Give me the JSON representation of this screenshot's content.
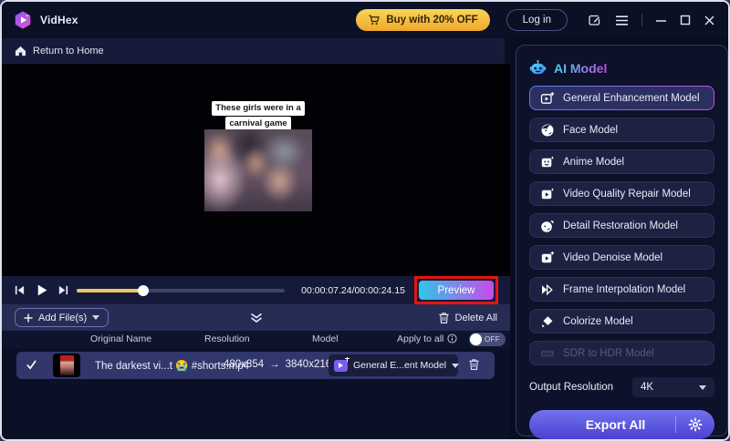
{
  "titlebar": {
    "app_name": "VidHex",
    "buy_label": "Buy with 20% OFF",
    "login_label": "Log in"
  },
  "nav": {
    "return_home": "Return to Home"
  },
  "player": {
    "caption_line1": "These girls were in a",
    "caption_line2": "carnival game",
    "time": "00:00:07.24/00:00:24.15",
    "progress_percent": 32,
    "preview_label": "Preview"
  },
  "file_toolbar": {
    "add_files_label": "Add File(s)",
    "delete_all_label": "Delete All"
  },
  "table": {
    "headers": {
      "original_name": "Original Name",
      "resolution": "Resolution",
      "model": "Model",
      "apply_to_all": "Apply to all"
    },
    "toggle_state": "OFF",
    "row": {
      "name": "The darkest vi...t 😭 #shorts.mp4",
      "resolution_from": "480x854",
      "arrow": "→",
      "resolution_to": "3840x2160",
      "model": "General E...ent Model"
    }
  },
  "ai_panel": {
    "title": "AI Model",
    "models": [
      {
        "label": "General Enhancement Model",
        "icon": "video-enhance-icon",
        "state": "selected"
      },
      {
        "label": "Face Model",
        "icon": "face-icon",
        "state": "default"
      },
      {
        "label": "Anime Model",
        "icon": "anime-icon",
        "state": "default"
      },
      {
        "label": "Video Quality Repair Model",
        "icon": "video-repair-icon",
        "state": "default"
      },
      {
        "label": "Detail Restoration Model",
        "icon": "detail-restoration-icon",
        "state": "default"
      },
      {
        "label": "Video Denoise Model",
        "icon": "video-denoise-icon",
        "state": "default"
      },
      {
        "label": "Frame Interpolation Model",
        "icon": "frame-interpolation-icon",
        "state": "default"
      },
      {
        "label": "Colorize Model",
        "icon": "colorize-icon",
        "state": "default"
      },
      {
        "label": "SDR to HDR Model",
        "icon": "hdr-icon",
        "state": "disabled"
      }
    ],
    "hdr_badge": "HDR",
    "output_resolution_label": "Output Resolution",
    "output_resolution_value": "4K",
    "export_label": "Export All"
  },
  "colors": {
    "accent_gradient_start": "#41d7f0",
    "accent_gradient_end": "#c34fe8",
    "buy_gold": "#f2bc3c",
    "preview_gradient_start": "#30c6e8",
    "preview_gradient_end": "#c94ae8",
    "export_indigo": "#5a55e0",
    "slider_yellow": "#ecc95f",
    "annotation_red": "#e51414",
    "selected_border_start": "#4b82f2",
    "selected_border_end": "#c24fe2"
  }
}
